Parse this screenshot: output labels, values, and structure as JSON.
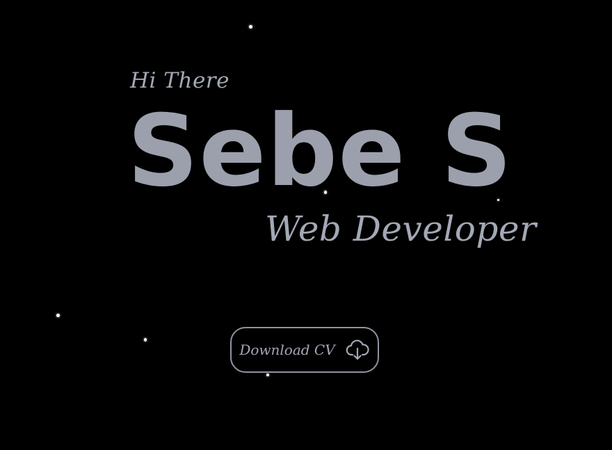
{
  "hero": {
    "greeting": "Hi There",
    "name": "Sebe S",
    "role": "Web Developer"
  },
  "cta": {
    "download_label": "Download CV",
    "icon": "cloud-download-icon"
  },
  "colors": {
    "background": "#000000",
    "text": "#a3a8b6",
    "name": "#9ca0ad",
    "button_border": "#8f94a1",
    "star": "#ffffff"
  }
}
